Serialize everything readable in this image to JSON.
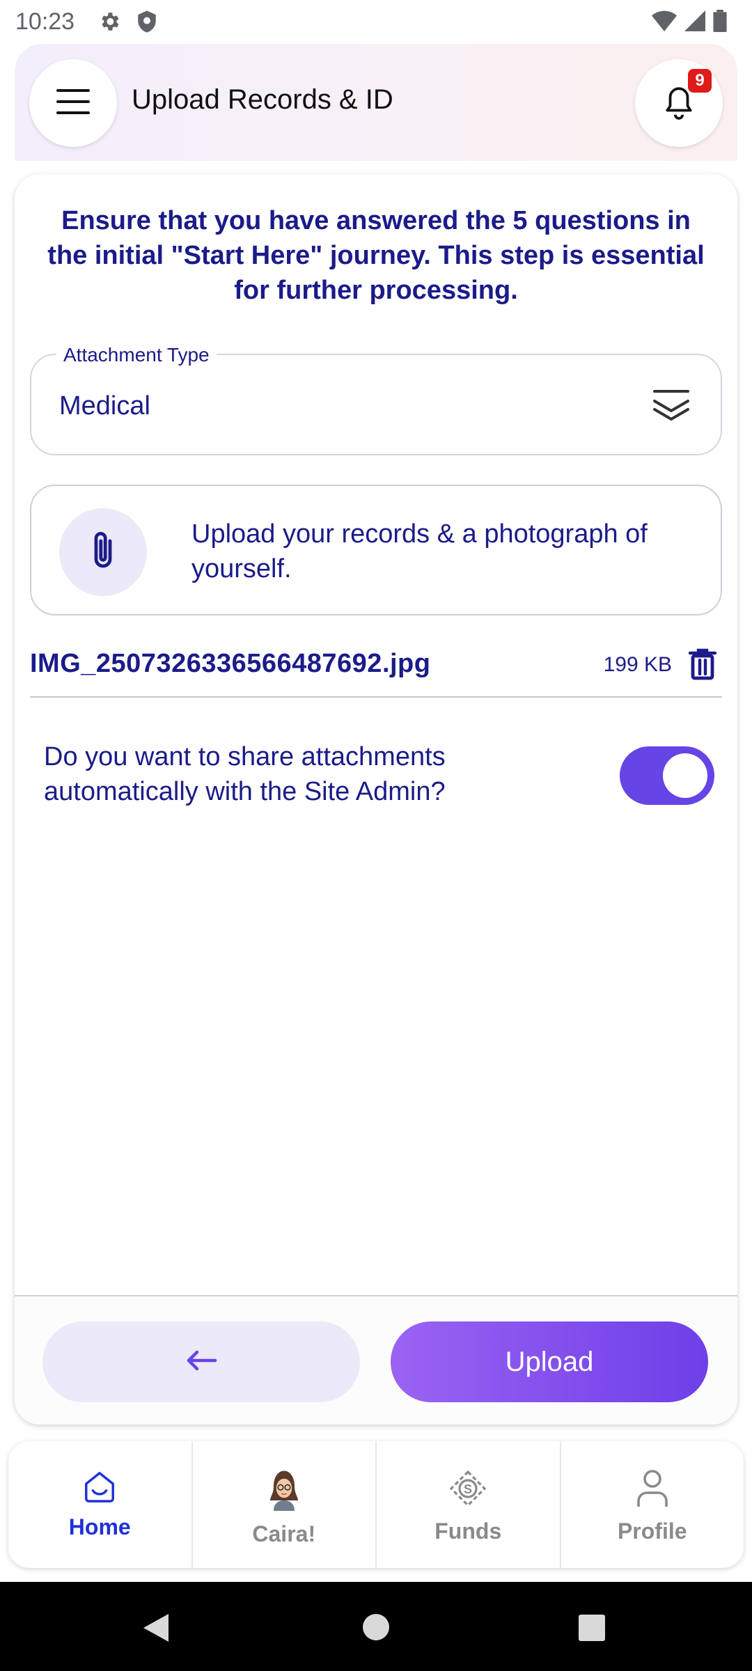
{
  "status_bar": {
    "time": "10:23",
    "icons": [
      "gear-icon",
      "shield-icon",
      "wifi-icon",
      "signal-icon",
      "battery-icon"
    ]
  },
  "header": {
    "title": "Upload Records & ID",
    "notification_count": "9"
  },
  "notice": "Ensure that you have answered the 5 questions in the initial \"Start Here\" journey. This step is essential for further processing.",
  "attachment_type": {
    "label": "Attachment Type",
    "value": "Medical"
  },
  "upload_box": {
    "text": "Upload your records & a photograph of yourself."
  },
  "file": {
    "name": "IMG_2507326336566487692.jpg",
    "size": "199 KB"
  },
  "share": {
    "question": "Do you want to share attachments automatically with the Site Admin?",
    "enabled": true
  },
  "actions": {
    "upload_label": "Upload"
  },
  "bottom_nav": {
    "items": [
      {
        "label": "Home",
        "icon": "home-icon",
        "active": true
      },
      {
        "label": "Caira!",
        "icon": "avatar-icon",
        "active": false
      },
      {
        "label": "Funds",
        "icon": "funds-icon",
        "active": false
      },
      {
        "label": "Profile",
        "icon": "profile-icon",
        "active": false
      }
    ]
  },
  "colors": {
    "primary_text": "#1b1b8a",
    "accent": "#6644e6",
    "active_nav": "#1f31d9",
    "badge": "#e01919"
  }
}
